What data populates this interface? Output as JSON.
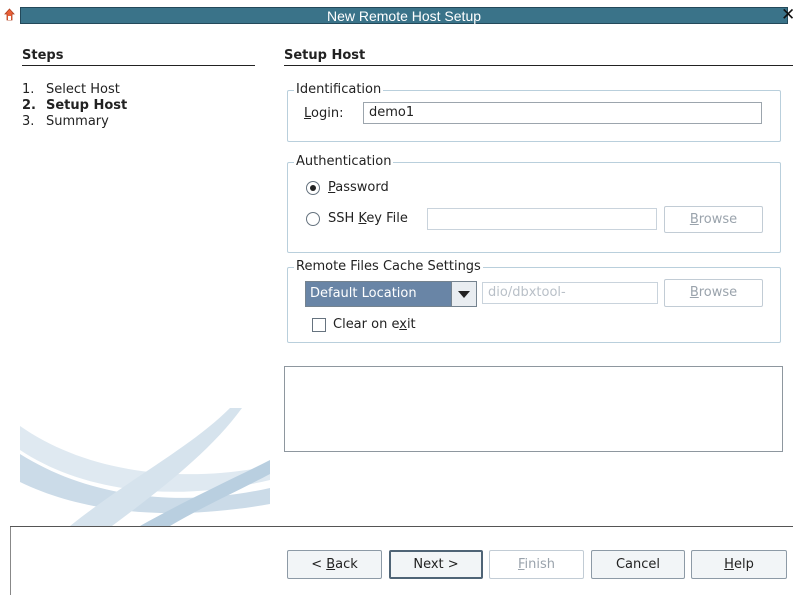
{
  "window": {
    "title": "New Remote Host Setup",
    "app_icon": "app-icon",
    "close_icon": "close-icon",
    "close_glyph": "✕"
  },
  "steps": {
    "heading": "Steps",
    "items": [
      {
        "num": "1.",
        "label": "Select Host"
      },
      {
        "num": "2.",
        "label": "Setup Host"
      },
      {
        "num": "3.",
        "label": "Summary"
      }
    ],
    "current_index": 2
  },
  "main": {
    "heading": "Setup Host",
    "identification": {
      "legend": "Identification",
      "login_mnemonic": "L",
      "login_rest": "ogin:",
      "login_value": "demo1"
    },
    "authentication": {
      "legend": "Authentication",
      "password_mnemonic": "P",
      "password_rest": "assword",
      "password_selected": true,
      "ssh_prefix": "SSH ",
      "ssh_mnemonic": "K",
      "ssh_rest": "ey File",
      "ssh_selected": false,
      "key_file_value": "",
      "browse_mnemonic": "B",
      "browse_rest": "rowse"
    },
    "cache": {
      "legend": "Remote Files Cache Settings",
      "location_selected": "Default Location",
      "path_value": "dio/dbxtool-",
      "browse_mnemonic": "B",
      "browse_rest": "rowse",
      "clear_prefix": "Clear on e",
      "clear_mnemonic": "x",
      "clear_rest": "it",
      "clear_checked": false
    },
    "message": ""
  },
  "footer": {
    "back_prefix": "< ",
    "back_mnemonic": "B",
    "back_rest": "ack",
    "next": "Next >",
    "finish_mnemonic": "F",
    "finish_rest": "inish",
    "cancel": "Cancel",
    "help_mnemonic": "H",
    "help_rest": "elp"
  },
  "colors": {
    "titlebar": "#3a7389",
    "group_border": "#b9cfdc",
    "combo_selected": "#6985a6"
  }
}
